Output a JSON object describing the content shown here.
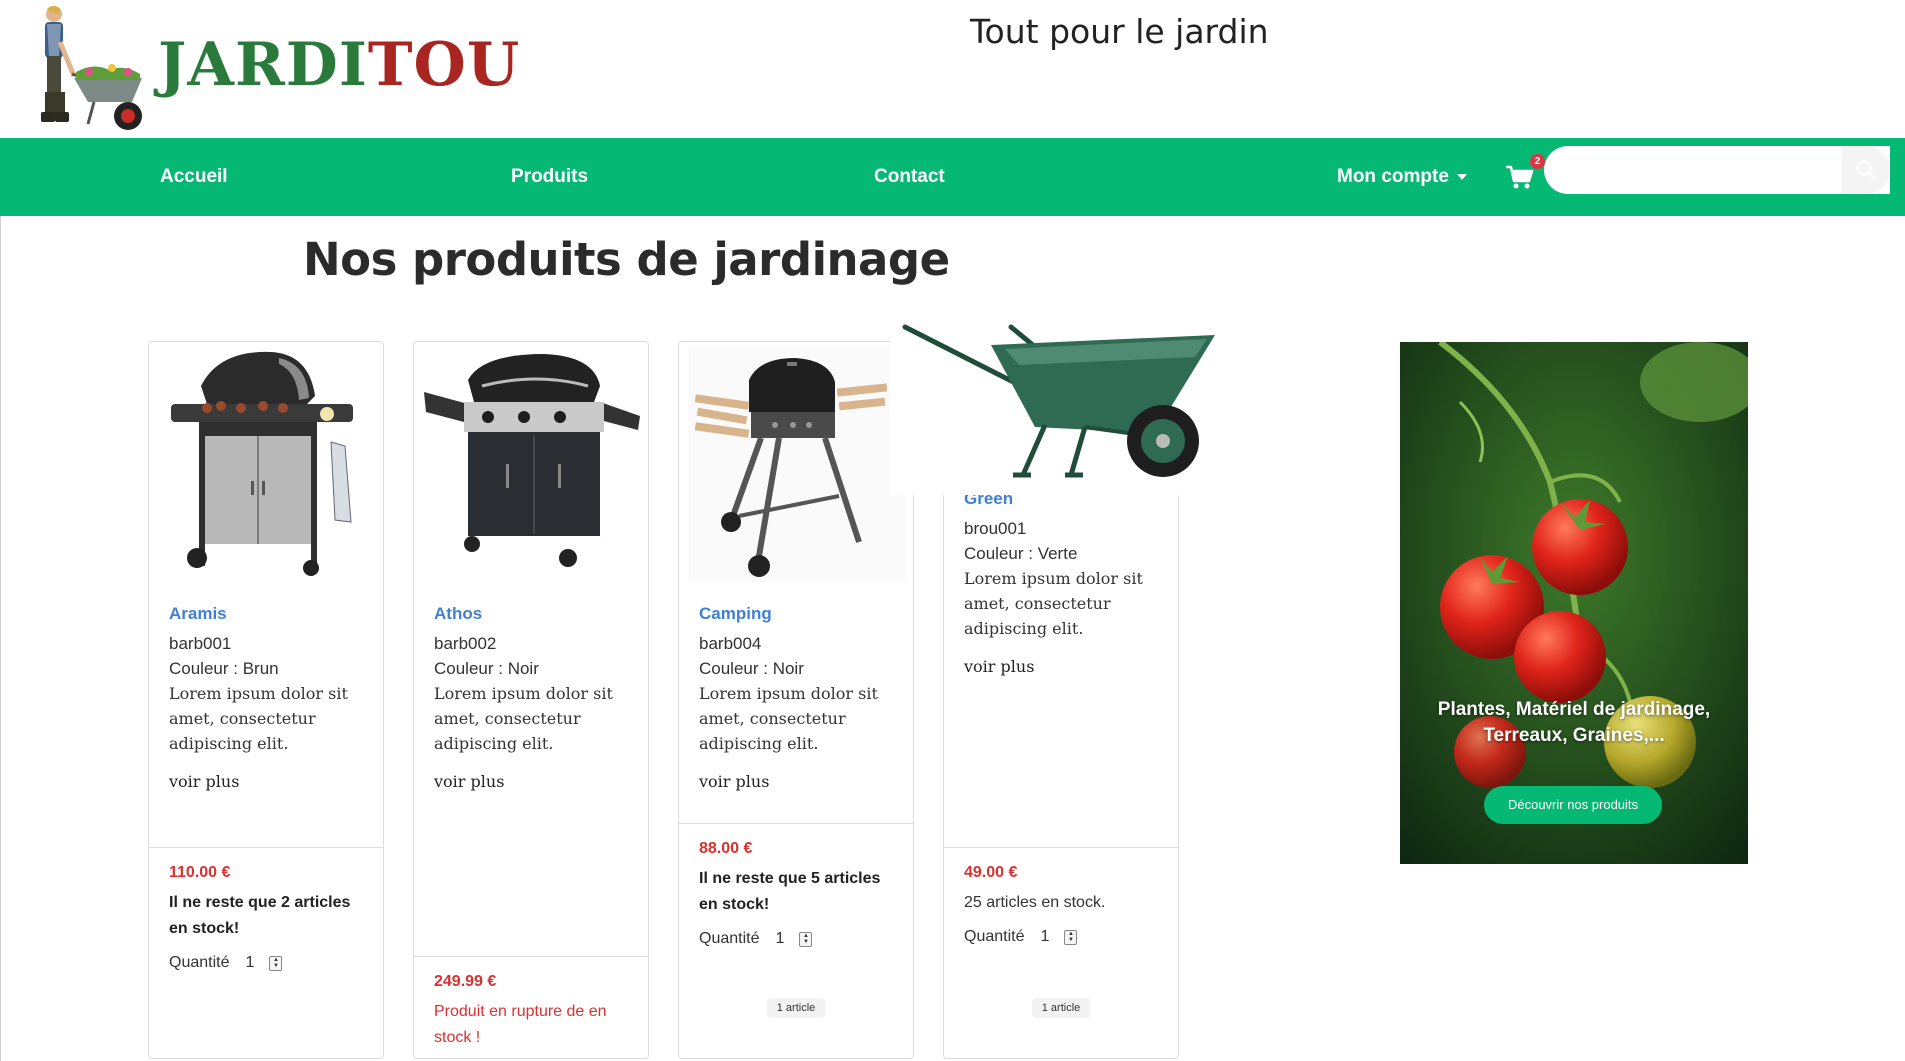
{
  "brand": {
    "name_part1": "JARDI",
    "name_part2": "TOU",
    "tagline": "Tout pour le jardin"
  },
  "nav": {
    "home": "Accueil",
    "products": "Produits",
    "contact": "Contact",
    "account": "Mon compte",
    "cart_count": "2",
    "search_placeholder": "",
    "search_value": ""
  },
  "page_title": "Nos produits de jardinage",
  "products": [
    {
      "name": "Aramis",
      "ref": "barb001",
      "color": "Couleur : Brun",
      "desc": "Lorem ipsum dolor sit amet, consectetur adipiscing elit.",
      "more": "voir plus",
      "price": "110.00 €",
      "stock": "Il ne reste que 2 articles en stock!",
      "qty_label": "Quantité",
      "qty": "1",
      "cart_tag": ""
    },
    {
      "name": "Athos",
      "ref": "barb002",
      "color": "Couleur : Noir",
      "desc": "Lorem ipsum dolor sit amet, consectetur adipiscing elit.",
      "more": "voir plus",
      "price": "249.99 €",
      "stock": "Produit en rupture de en stock !",
      "qty_label": "",
      "qty": "",
      "cart_tag": ""
    },
    {
      "name": "Camping",
      "ref": "barb004",
      "color": "Couleur : Noir",
      "desc": "Lorem ipsum dolor sit amet, consectetur adipiscing elit.",
      "more": "voir plus",
      "price": "88.00 €",
      "stock": "Il ne reste que 5 articles en stock!",
      "qty_label": "Quantité",
      "qty": "1",
      "cart_tag": "1 article"
    },
    {
      "name": "Green",
      "ref": "brou001",
      "color": "Couleur : Verte",
      "desc": "Lorem ipsum dolor sit amet, consectetur adipiscing elit.",
      "more": "voir plus",
      "price": "49.00 €",
      "stock": "25 articles en stock.",
      "qty_label": "Quantité",
      "qty": "1",
      "cart_tag": "1 article"
    }
  ],
  "promo": {
    "text": "Plantes, Matériel de jardinage, Terreaux, Graines,...",
    "button": "Découvrir nos produits"
  },
  "colors": {
    "primary": "#05b874",
    "price": "#d9312f",
    "link": "#3f7fd6",
    "logo_green": "#2a7a3b",
    "logo_red": "#a8261f"
  }
}
